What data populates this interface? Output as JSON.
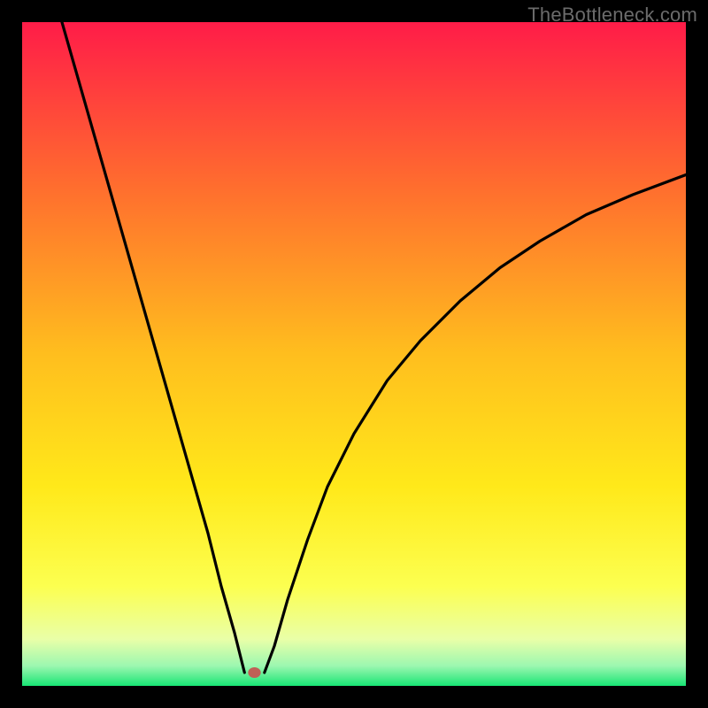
{
  "watermark": "TheBottleneck.com",
  "chart_data": {
    "type": "line",
    "title": "",
    "xlabel": "",
    "ylabel": "",
    "xlim": [
      0,
      100
    ],
    "ylim": [
      0,
      100
    ],
    "grid": false,
    "legend": false,
    "background_gradient": {
      "stops": [
        {
          "offset": 0.0,
          "color": "#ff1c48"
        },
        {
          "offset": 0.25,
          "color": "#ff6e2e"
        },
        {
          "offset": 0.5,
          "color": "#ffbe1e"
        },
        {
          "offset": 0.7,
          "color": "#ffe91a"
        },
        {
          "offset": 0.85,
          "color": "#fcff50"
        },
        {
          "offset": 0.93,
          "color": "#e9ffa8"
        },
        {
          "offset": 0.97,
          "color": "#9cf7b0"
        },
        {
          "offset": 1.0,
          "color": "#18e574"
        }
      ]
    },
    "annotations": [
      {
        "type": "point",
        "x": 35,
        "y": 2,
        "color": "#c06056",
        "radius": 6
      }
    ],
    "series": [
      {
        "name": "left-arm",
        "color": "#000000",
        "x": [
          6,
          8,
          10,
          12,
          14,
          16,
          18,
          20,
          22,
          24,
          26,
          28,
          30,
          32,
          33.5
        ],
        "y": [
          100,
          93,
          86,
          79,
          72,
          65,
          58,
          51,
          44,
          37,
          30,
          23,
          15,
          8,
          2
        ]
      },
      {
        "name": "right-arm",
        "color": "#000000",
        "x": [
          36.5,
          38,
          40,
          43,
          46,
          50,
          55,
          60,
          66,
          72,
          78,
          85,
          92,
          100
        ],
        "y": [
          2,
          6,
          13,
          22,
          30,
          38,
          46,
          52,
          58,
          63,
          67,
          71,
          74,
          77
        ]
      }
    ]
  }
}
